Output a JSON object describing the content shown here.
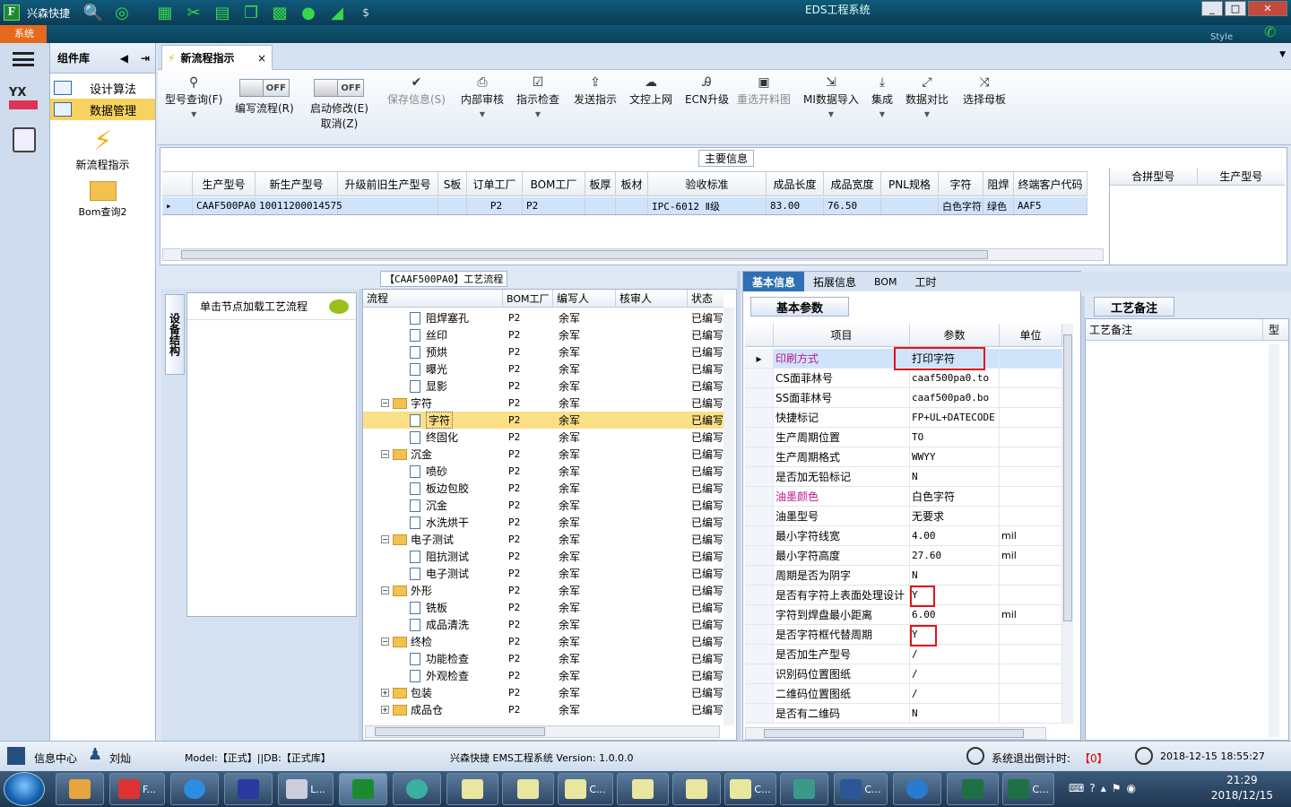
{
  "app": {
    "title": "兴森快捷",
    "window_title": "EDS工程系统",
    "sys_tab": "系统",
    "style_label": "Style"
  },
  "window_buttons": [
    "_",
    "□",
    "✕"
  ],
  "colors": {
    "accent": "#2f6fb3",
    "highlight_box": "#e0141b",
    "selected_row": "#cfe3fb",
    "tree_selected": "#fbdf86",
    "orange_tab": "#e66a1e"
  },
  "library": {
    "title": "组件库",
    "items": [
      {
        "label": "设计算法"
      },
      {
        "label": "数据管理"
      }
    ],
    "big_items": [
      {
        "label": "新流程指示",
        "icon": "lightning-icon"
      },
      {
        "label": "Bom查询2",
        "icon": "folder-open-icon"
      }
    ]
  },
  "doc_tab": {
    "label": "新流程指示"
  },
  "ribbon": {
    "query": "型号查询(F)",
    "toggle1": {
      "state": "OFF",
      "label": "编写流程(R)"
    },
    "toggle2": {
      "state": "OFF",
      "label": "启动修改(E)",
      "sub": "取消(Z)"
    },
    "buttons": [
      "保存信息(S)",
      "内部审核",
      "指示检查",
      "发送指示",
      "文控上网",
      "ECN升级",
      "重选开料图",
      "MI数据导入",
      "集成",
      "数据对比",
      "选择母板"
    ]
  },
  "main_info": {
    "caption": "主要信息",
    "headers": [
      "生产型号",
      "新生产型号",
      "升级前旧生产型号",
      "S板",
      "订单工厂",
      "BOM工厂",
      "板厚",
      "板材",
      "验收标准",
      "成品长度",
      "成品宽度",
      "PNL规格",
      "字符",
      "阻焊",
      "终端客户代码"
    ],
    "row": [
      "CAAF500PA0",
      "10011200014575",
      "",
      "",
      "P2",
      "P2",
      "",
      "",
      "IPC-6012 Ⅱ级",
      "83.00",
      "76.50",
      "",
      "白色字符",
      "绿色",
      "AAF5"
    ],
    "side_headers": [
      "合拼型号",
      "生产型号"
    ]
  },
  "flow": {
    "caption": "【CAAF500PA0】工艺流程",
    "vert_tab": "设备结构",
    "load_hint": "单击节点加载工艺流程",
    "headers": [
      "流程",
      "BOM工厂",
      "编写人",
      "核审人",
      "状态"
    ],
    "rows": [
      {
        "name": "阻焊塞孔",
        "lvl": 2,
        "bom": "P2",
        "who": "余军",
        "st": "已编写"
      },
      {
        "name": "丝印",
        "lvl": 2,
        "bom": "P2",
        "who": "余军",
        "st": "已编写"
      },
      {
        "name": "预烘",
        "lvl": 2,
        "bom": "P2",
        "who": "余军",
        "st": "已编写"
      },
      {
        "name": "曝光",
        "lvl": 2,
        "bom": "P2",
        "who": "余军",
        "st": "已编写"
      },
      {
        "name": "显影",
        "lvl": 2,
        "bom": "P2",
        "who": "余军",
        "st": "已编写"
      },
      {
        "name": "字符",
        "lvl": 1,
        "bom": "P2",
        "who": "余军",
        "st": "已编写"
      },
      {
        "name": "字符",
        "lvl": 2,
        "bom": "P2",
        "who": "余军",
        "st": "已编写",
        "sel": true
      },
      {
        "name": "终固化",
        "lvl": 2,
        "bom": "P2",
        "who": "余军",
        "st": "已编写"
      },
      {
        "name": "沉金",
        "lvl": 1,
        "bom": "P2",
        "who": "余军",
        "st": "已编写"
      },
      {
        "name": "喷砂",
        "lvl": 2,
        "bom": "P2",
        "who": "余军",
        "st": "已编写"
      },
      {
        "name": "板边包胶",
        "lvl": 2,
        "bom": "P2",
        "who": "余军",
        "st": "已编写"
      },
      {
        "name": "沉金",
        "lvl": 2,
        "bom": "P2",
        "who": "余军",
        "st": "已编写"
      },
      {
        "name": "水洗烘干",
        "lvl": 2,
        "bom": "P2",
        "who": "余军",
        "st": "已编写"
      },
      {
        "name": "电子测试",
        "lvl": 1,
        "bom": "P2",
        "who": "余军",
        "st": "已编写"
      },
      {
        "name": "阻抗测试",
        "lvl": 2,
        "bom": "P2",
        "who": "余军",
        "st": "已编写"
      },
      {
        "name": "电子测试",
        "lvl": 2,
        "bom": "P2",
        "who": "余军",
        "st": "已编写"
      },
      {
        "name": "外形",
        "lvl": 1,
        "bom": "P2",
        "who": "余军",
        "st": "已编写"
      },
      {
        "name": "铣板",
        "lvl": 2,
        "bom": "P2",
        "who": "余军",
        "st": "已编写"
      },
      {
        "name": "成品清洗",
        "lvl": 2,
        "bom": "P2",
        "who": "余军",
        "st": "已编写"
      },
      {
        "name": "终检",
        "lvl": 1,
        "bom": "P2",
        "who": "余军",
        "st": "已编写"
      },
      {
        "name": "功能检查",
        "lvl": 2,
        "bom": "P2",
        "who": "余军",
        "st": "已编写"
      },
      {
        "name": "外观检查",
        "lvl": 2,
        "bom": "P2",
        "who": "余军",
        "st": "已编写"
      },
      {
        "name": "包装",
        "lvl": 1,
        "bom": "P2",
        "who": "余军",
        "st": "已编写",
        "plus": true
      },
      {
        "name": "成品仓",
        "lvl": 1,
        "bom": "P2",
        "who": "余军",
        "st": "已编写",
        "plus": true
      }
    ]
  },
  "props": {
    "tabs": [
      "基本信息",
      "拓展信息",
      "BOM",
      "工时"
    ],
    "sub_tab": "基本参数",
    "headers": [
      "项目",
      "参数",
      "单位"
    ],
    "rows": [
      {
        "k": "印刷方式",
        "v": "打印字符",
        "u": "",
        "pink": true
      },
      {
        "k": "CS面菲林号",
        "v": "caaf500pa0.to",
        "u": ""
      },
      {
        "k": "SS面菲林号",
        "v": "caaf500pa0.bo",
        "u": ""
      },
      {
        "k": "快捷标记",
        "v": "FP+UL+DATECODE",
        "u": ""
      },
      {
        "k": "生产周期位置",
        "v": "TO",
        "u": ""
      },
      {
        "k": "生产周期格式",
        "v": "WWYY",
        "u": ""
      },
      {
        "k": "是否加无铅标记",
        "v": "N",
        "u": ""
      },
      {
        "k": "油墨颜色",
        "v": "白色字符",
        "u": "",
        "pink": true
      },
      {
        "k": "油墨型号",
        "v": "无要求",
        "u": ""
      },
      {
        "k": "最小字符线宽",
        "v": "4.00",
        "u": "mil"
      },
      {
        "k": "最小字符高度",
        "v": "27.60",
        "u": "mil"
      },
      {
        "k": "周期是否为阴字",
        "v": "N",
        "u": ""
      },
      {
        "k": "是否有字符上表面处理设计",
        "v": "Y",
        "u": ""
      },
      {
        "k": "字符到焊盘最小距离",
        "v": "6.00",
        "u": "mil"
      },
      {
        "k": "是否字符框代替周期",
        "v": "Y",
        "u": ""
      },
      {
        "k": "是否加生产型号",
        "v": "/",
        "u": ""
      },
      {
        "k": "识别码位置图纸",
        "v": "/",
        "u": ""
      },
      {
        "k": "二维码位置图纸",
        "v": "/",
        "u": ""
      },
      {
        "k": "是否有二维码",
        "v": "N",
        "u": ""
      }
    ]
  },
  "notes": {
    "tab": "工艺备注",
    "col1": "工艺备注",
    "col2": "型"
  },
  "status": {
    "center": "信息中心",
    "user": "刘灿",
    "model": "Model:【正式】||DB:【正式库】",
    "version": "兴森快捷 EMS工程系统 Version: 1.0.0.0",
    "countdown_label": "系统退出倒计时:",
    "countdown_value": "【0】",
    "datetime": "2018-12-15 18:55:27"
  },
  "taskbar": {
    "time": "21:29",
    "date": "2018/12/15",
    "buttons": [
      "F...",
      "L...",
      "C...",
      "C...",
      "C...",
      "C..."
    ]
  }
}
